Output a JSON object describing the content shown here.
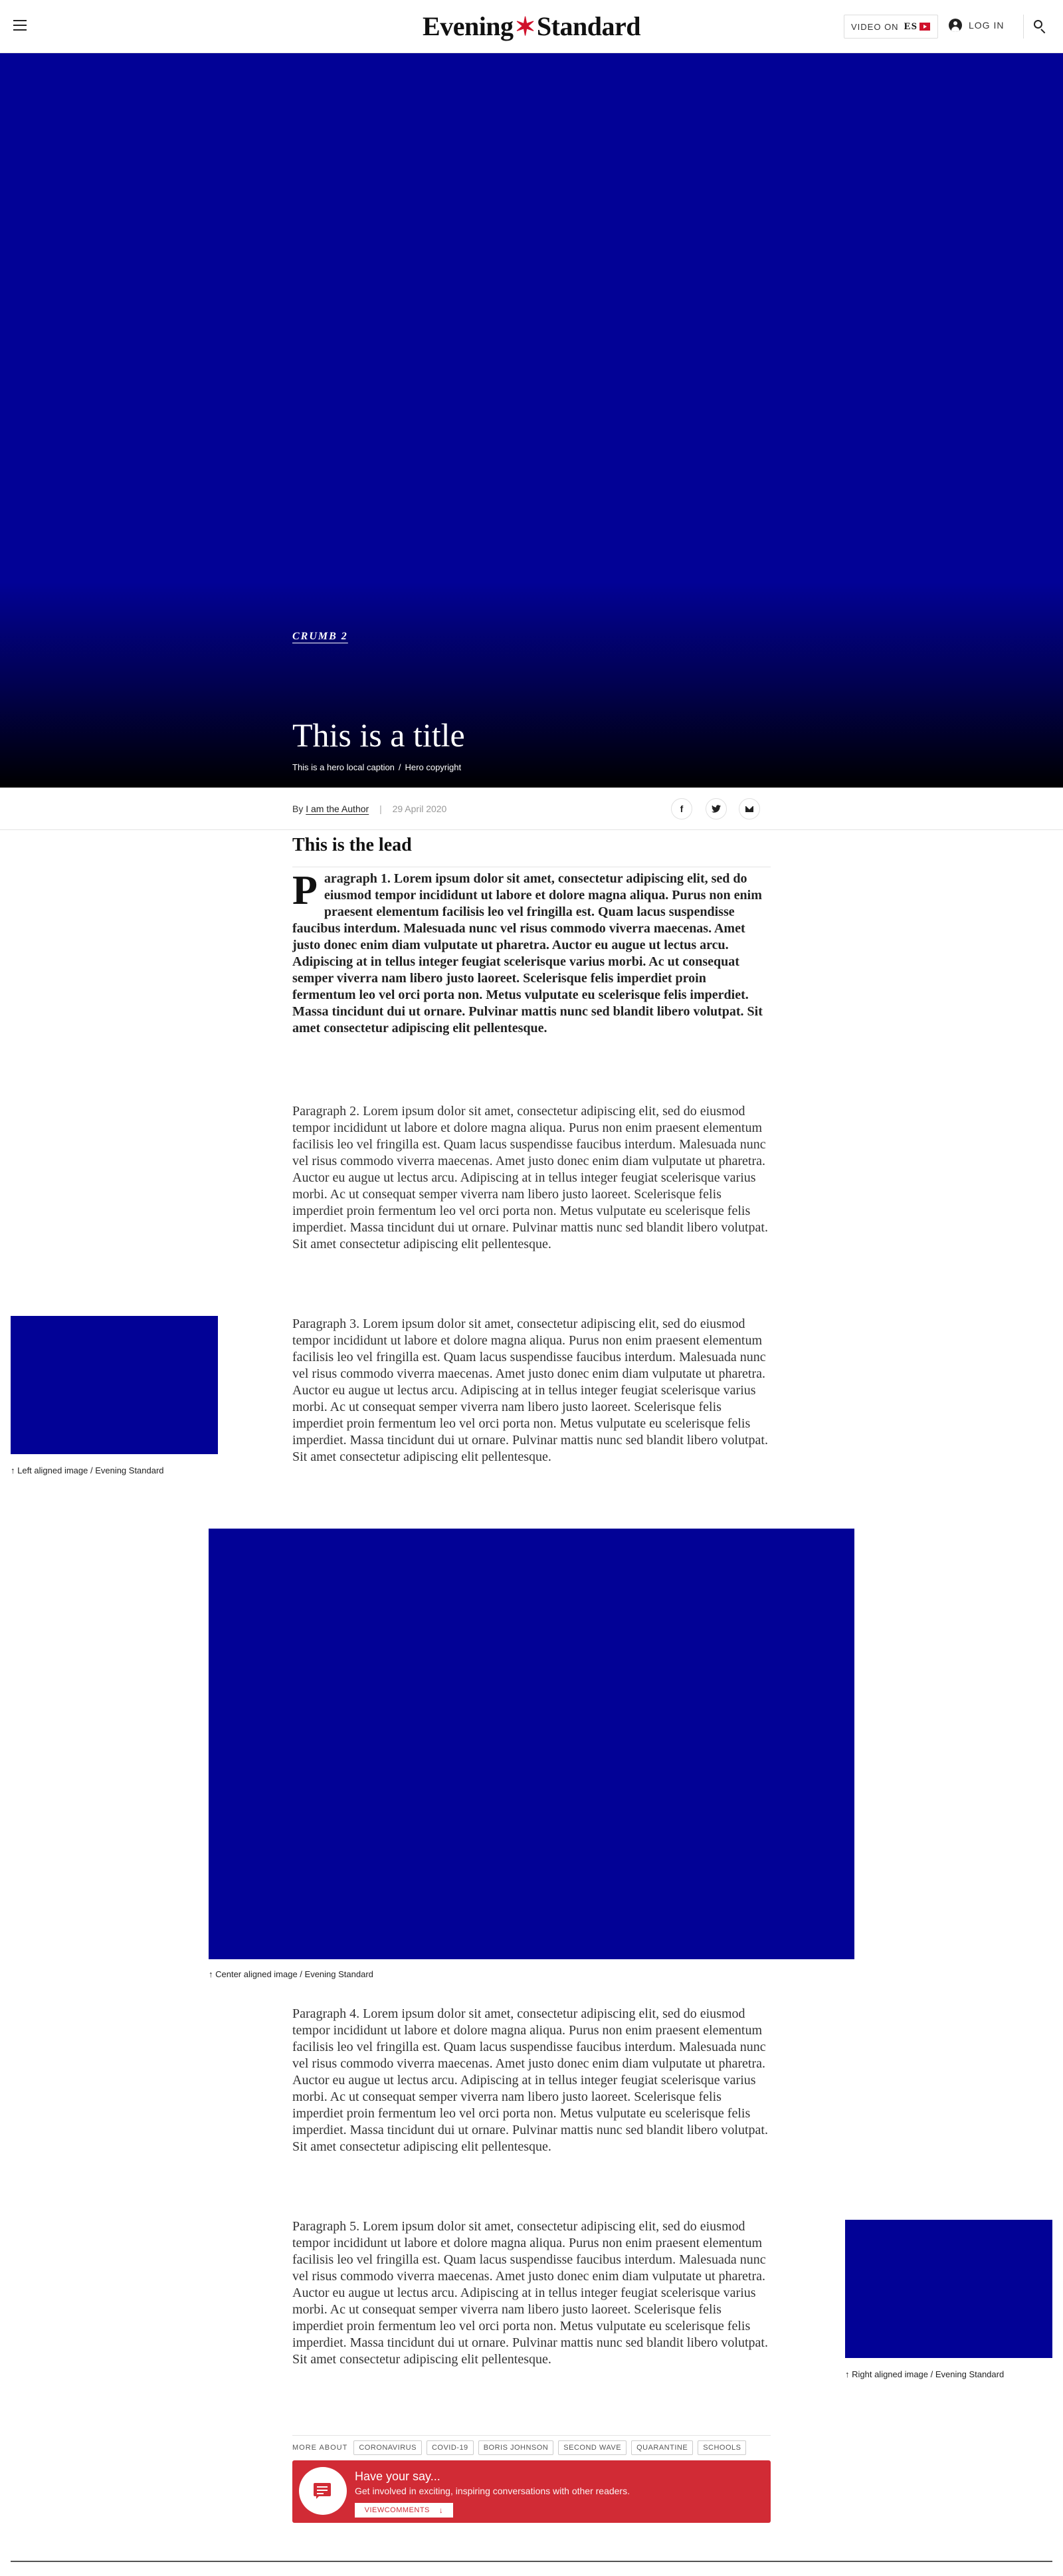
{
  "header": {
    "logo_left": "Evening",
    "logo_right": "Standard",
    "video_on_label": "VIDEO ON",
    "video_brand": "ES",
    "login_label": "LOG IN",
    "icons": [
      "hamburger-menu-icon",
      "play-icon",
      "user-icon",
      "search-icon"
    ],
    "accent_color": "#d0112b"
  },
  "hero": {
    "crumb": "CRUMB 2",
    "title": "This is a title",
    "caption": "This is a hero local caption",
    "copyright": "Hero copyright",
    "background_color": "#020296"
  },
  "byline": {
    "prefix": "By",
    "author": "I am the Author",
    "divider": "|",
    "date": "29 April 2020",
    "share": {
      "facebook": "f",
      "twitter": "t",
      "email_icon": "mail-icon"
    }
  },
  "article": {
    "lead": "This is the lead",
    "dropcap": "P",
    "p1": "aragraph 1. Lorem ipsum dolor sit amet, consectetur adipiscing elit, sed do eiusmod tempor incididunt ut labore et dolore magna aliqua. Purus non enim praesent elementum facilisis leo vel fringilla est. Quam lacus suspendisse faucibus interdum. Malesuada nunc vel risus commodo viverra maecenas. Amet justo donec enim diam vulputate ut pharetra. Auctor eu augue ut lectus arcu. Adipiscing at in tellus integer feugiat scelerisque varius morbi. Ac ut consequat semper viverra nam libero justo laoreet. Scelerisque felis imperdiet proin fermentum leo vel orci porta non. Metus vulputate eu scelerisque felis imperdiet. Massa tincidunt dui ut ornare. Pulvinar mattis nunc sed blandit libero volutpat. Sit amet consectetur adipiscing elit pellentesque.",
    "p2": "Paragraph 2. Lorem ipsum dolor sit amet, consectetur adipiscing elit, sed do eiusmod tempor incididunt ut labore et dolore magna aliqua. Purus non enim praesent elementum facilisis leo vel fringilla est. Quam lacus suspendisse faucibus interdum. Malesuada nunc vel risus commodo viverra maecenas. Amet justo donec enim diam vulputate ut pharetra. Auctor eu augue ut lectus arcu. Adipiscing at in tellus integer feugiat scelerisque varius morbi. Ac ut consequat semper viverra nam libero justo laoreet. Scelerisque felis imperdiet proin fermentum leo vel orci porta non. Metus vulputate eu scelerisque felis imperdiet. Massa tincidunt dui ut ornare. Pulvinar mattis nunc sed blandit libero volutpat. Sit amet consectetur adipiscing elit pellentesque.",
    "p3": "Paragraph 3. Lorem ipsum dolor sit amet, consectetur adipiscing elit, sed do eiusmod tempor incididunt ut labore et dolore magna aliqua. Purus non enim praesent elementum facilisis leo vel fringilla est. Quam lacus suspendisse faucibus interdum. Malesuada nunc vel risus commodo viverra maecenas. Amet justo donec enim diam vulputate ut pharetra. Auctor eu augue ut lectus arcu. Adipiscing at in tellus integer feugiat scelerisque varius morbi. Ac ut consequat semper viverra nam libero justo laoreet. Scelerisque felis imperdiet proin fermentum leo vel orci porta non. Metus vulputate eu scelerisque felis imperdiet. Massa tincidunt dui ut ornare. Pulvinar mattis nunc sed blandit libero volutpat. Sit amet consectetur adipiscing elit pellentesque.",
    "p4": "Paragraph 4. Lorem ipsum dolor sit amet, consectetur adipiscing elit, sed do eiusmod tempor incididunt ut labore et dolore magna aliqua. Purus non enim praesent elementum facilisis leo vel fringilla est. Quam lacus suspendisse faucibus interdum. Malesuada nunc vel risus commodo viverra maecenas. Amet justo donec enim diam vulputate ut pharetra. Auctor eu augue ut lectus arcu. Adipiscing at in tellus integer feugiat scelerisque varius morbi. Ac ut consequat semper viverra nam libero justo laoreet. Scelerisque felis imperdiet proin fermentum leo vel orci porta non. Metus vulputate eu scelerisque felis imperdiet. Massa tincidunt dui ut ornare. Pulvinar mattis nunc sed blandit libero volutpat. Sit amet consectetur adipiscing elit pellentesque.",
    "p5": "Paragraph 5. Lorem ipsum dolor sit amet, consectetur adipiscing elit, sed do eiusmod tempor incididunt ut labore et dolore magna aliqua. Purus non enim praesent elementum facilisis leo vel fringilla est. Quam lacus suspendisse faucibus interdum. Malesuada nunc vel risus commodo viverra maecenas. Amet justo donec enim diam vulputate ut pharetra. Auctor eu augue ut lectus arcu. Adipiscing at in tellus integer feugiat scelerisque varius morbi. Ac ut consequat semper viverra nam libero justo laoreet. Scelerisque felis imperdiet proin fermentum leo vel orci porta non. Metus vulputate eu scelerisque felis imperdiet. Massa tincidunt dui ut ornare. Pulvinar mattis nunc sed blandit libero volutpat. Sit amet consectetur adipiscing elit pellentesque.",
    "images": {
      "left_caption": "↑ Left aligned image / Evening Standard",
      "center_caption": "↑ Center aligned image / Evening Standard",
      "right_caption": "↑ Right aligned image / Evening Standard",
      "color": "#020296"
    }
  },
  "tags": {
    "label": "MORE ABOUT",
    "items": [
      "CORONAVIRUS",
      "COVID-19",
      "BORIS JOHNSON",
      "SECOND WAVE",
      "QUARANTINE",
      "SCHOOLS"
    ]
  },
  "comments": {
    "title": "Have your say...",
    "subtitle": "Get involved in exciting, inspiring conversations with other readers.",
    "button": "VIEWCOMMENTS",
    "button_arrow": "↓",
    "color": "#d12b35"
  }
}
